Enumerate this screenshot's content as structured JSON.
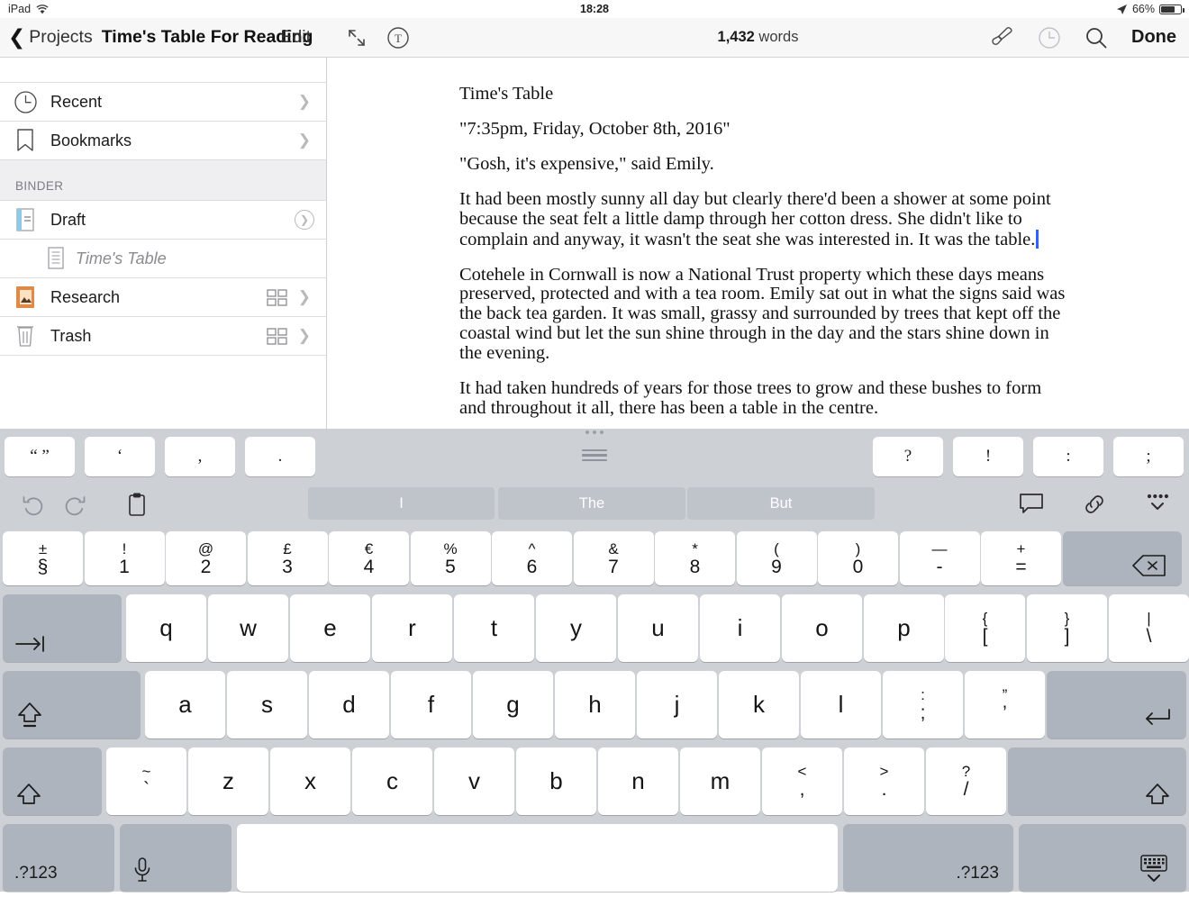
{
  "status_bar": {
    "device": "iPad",
    "wifi_icon": "wifi-icon",
    "time": "18:28",
    "location_icon": "location-arrow-icon",
    "battery_percent": "66%",
    "battery_level": 66
  },
  "nav_left": {
    "back_icon": "chevron-left-icon",
    "back_label": "Projects",
    "title": "Time's Table For Reading",
    "edit_label": "Edit"
  },
  "nav_right": {
    "expand_icon": "expand-arrows-icon",
    "typography_icon": "text-format-icon",
    "word_count_number": "1,432",
    "word_count_unit": " words",
    "brush_icon": "paintbrush-icon",
    "history_icon": "clock-icon",
    "search_icon": "search-icon",
    "done_label": "Done"
  },
  "sidebar": {
    "quick": [
      {
        "label": "Recent",
        "icon": "clock-icon",
        "accessory": "chevron"
      },
      {
        "label": "Bookmarks",
        "icon": "bookmark-icon",
        "accessory": "chevron"
      }
    ],
    "section_header": "BINDER",
    "items": [
      {
        "label": "Draft",
        "icon": "draft-document-icon",
        "accessory": "circle-chevron",
        "grid": false,
        "indent": false,
        "italic": false
      },
      {
        "label": "Time's Table",
        "icon": "text-document-icon",
        "accessory": "none",
        "grid": false,
        "indent": true,
        "italic": true
      },
      {
        "label": "Research",
        "icon": "research-folder-icon",
        "accessory": "chevron",
        "grid": true,
        "indent": false,
        "italic": false
      },
      {
        "label": "Trash",
        "icon": "trash-icon",
        "accessory": "chevron",
        "grid": true,
        "indent": false,
        "italic": false
      }
    ]
  },
  "document": {
    "paragraphs": [
      "Time's Table",
      "\"7:35pm, Friday, October 8th, 2016\"",
      "\"Gosh, it's expensive,\" said Emily.",
      "It had been mostly sunny all day but clearly there'd been a shower at some point because the seat felt a little damp through her cotton dress. She didn't like to complain and anyway, it wasn't the seat she was interested in. It was the table.",
      "Cotehele in Cornwall is now a National Trust property which these days means preserved, protected and with a tea room. Emily sat out in what the signs said was the back tea garden. It was small, grassy and surrounded by trees that kept off the coastal wind but let the sun shine through in the day and the stars shine down in the evening.",
      "It had taken hundreds of years for those trees to grow and these bushes to form and throughout it all, there has been a table in the centre."
    ],
    "caret_after_paragraph": 3
  },
  "keyboard": {
    "shortcut_keys_left": [
      "“ ”",
      "‘",
      ",",
      "."
    ],
    "shortcut_keys_right": [
      "?",
      "!",
      ":",
      ";"
    ],
    "grabber_icon": "keyboard-drag-handle-icon",
    "toolbar": {
      "undo_icon": "undo-icon",
      "redo_icon": "redo-icon",
      "paste_icon": "clipboard-icon",
      "comment_icon": "comment-icon",
      "link_icon": "link-icon",
      "more_icon": "more-options-icon"
    },
    "predictions": [
      "I",
      "The",
      "But"
    ],
    "number_row": [
      {
        "upper": "±",
        "lower": "§"
      },
      {
        "upper": "!",
        "lower": "1"
      },
      {
        "upper": "@",
        "lower": "2"
      },
      {
        "upper": "£",
        "lower": "3"
      },
      {
        "upper": "€",
        "lower": "4"
      },
      {
        "upper": "%",
        "lower": "5"
      },
      {
        "upper": "^",
        "lower": "6"
      },
      {
        "upper": "&",
        "lower": "7"
      },
      {
        "upper": "*",
        "lower": "8"
      },
      {
        "upper": "(",
        "lower": "9"
      },
      {
        "upper": ")",
        "lower": "0"
      },
      {
        "upper": "—",
        "lower": "-"
      },
      {
        "upper": "+",
        "lower": "="
      }
    ],
    "delete_key_icon": "backspace-icon",
    "tab_key_icon": "tab-icon",
    "row_q": [
      "q",
      "w",
      "e",
      "r",
      "t",
      "y",
      "u",
      "i",
      "o",
      "p"
    ],
    "row_q_extra": [
      {
        "upper": "{",
        "lower": "["
      },
      {
        "upper": "}",
        "lower": "]"
      },
      {
        "upper": "|",
        "lower": "\\"
      }
    ],
    "caps_lock_icon": "caps-lock-icon",
    "row_a": [
      "a",
      "s",
      "d",
      "f",
      "g",
      "h",
      "j",
      "k",
      "l"
    ],
    "row_a_extra": [
      {
        "upper": ":",
        "lower": ";"
      },
      {
        "upper": "”",
        "lower": "’"
      }
    ],
    "return_key_icon": "return-icon",
    "shift_icon": "shift-icon",
    "tilde_key": {
      "upper": "~",
      "lower": "`"
    },
    "row_z": [
      "z",
      "x",
      "c",
      "v",
      "b",
      "n",
      "m"
    ],
    "row_z_extra": [
      {
        "upper": "<",
        "lower": ","
      },
      {
        "upper": ">",
        "lower": "."
      },
      {
        "upper": "?",
        "lower": "/"
      }
    ],
    "numeric_key_left": ".?123",
    "numeric_key_right": ".?123",
    "dictation_icon": "microphone-icon",
    "space_key": "",
    "dismiss_icon": "hide-keyboard-icon"
  },
  "colors": {
    "keyboard_bg": "#cdd1d6",
    "key_face": "#ffffff",
    "key_mod": "#aeb4bd",
    "prediction_chip": "#bfc4cb",
    "caret": "#3060ff",
    "draft_icon": "#8ec9e8",
    "research_icon": "#e08a4a"
  }
}
